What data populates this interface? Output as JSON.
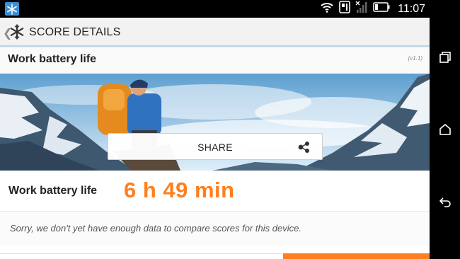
{
  "status_bar": {
    "time": "11:07",
    "icons": [
      "snowflake-app-icon",
      "wifi-icon",
      "nfc-icon",
      "no-signal-icon",
      "battery-icon"
    ]
  },
  "action_bar": {
    "title": "SCORE DETAILS",
    "icons": [
      "back-chevron-icon",
      "snowflake-logo-icon"
    ]
  },
  "card": {
    "title": "Work battery life",
    "version": "(v1.1)",
    "share_label": "SHARE",
    "result_label": "Work battery life",
    "result_value": "6 h 49 min",
    "compare_note": "Sorry, we don't yet have enough data to compare scores for this device."
  },
  "nav_bar": {
    "icons": [
      "recent-apps-icon",
      "home-icon",
      "back-icon"
    ]
  },
  "colors": {
    "accent_orange": "#ff7f1e",
    "action_bar_divider": "#b6d6ea",
    "app_icon_blue": "#3a8fd6"
  }
}
